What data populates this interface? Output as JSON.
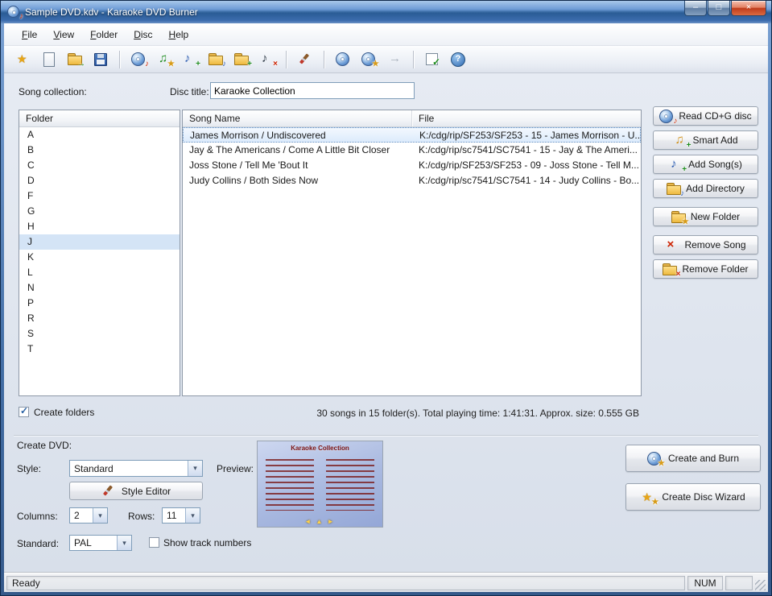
{
  "window": {
    "title": "Sample DVD.kdv - Karaoke DVD Burner"
  },
  "colors": {
    "titlebar_blue": "#2e62a8",
    "close_red": "#c73a1d",
    "selection_blue": "#d4e4f6",
    "folder_yellow": "#edb93f"
  },
  "menu": {
    "items": [
      "File",
      "View",
      "Folder",
      "Disc",
      "Help"
    ]
  },
  "toolbar": {
    "icons": [
      "new-project-wizard",
      "new-document",
      "open-file",
      "save",
      "read-cdg-disc",
      "smart-add",
      "add-songs",
      "add-directory",
      "new-folder",
      "remove-song",
      "style-editor",
      "create-and-burn",
      "create-disc-wizard",
      "forward-disabled",
      "check-disc",
      "help"
    ]
  },
  "collection": {
    "song_collection_label": "Song collection:",
    "disc_title_label": "Disc title:",
    "disc_title_value": "Karaoke Collection"
  },
  "folders": {
    "header": "Folder",
    "selected": "J",
    "items": [
      "A",
      "B",
      "C",
      "D",
      "F",
      "G",
      "H",
      "J",
      "K",
      "L",
      "N",
      "P",
      "R",
      "S",
      "T"
    ]
  },
  "songs": {
    "columns": {
      "name": "Song Name",
      "file": "File"
    },
    "selected_index": 0,
    "rows": [
      {
        "name": "James Morrison / Undiscovered",
        "file": "K:/cdg/rip/SF253/SF253 - 15 - James Morrison - U..."
      },
      {
        "name": "Jay & The Americans / Come A Little Bit Closer",
        "file": "K:/cdg/rip/sc7541/SC7541 - 15 - Jay & The Ameri..."
      },
      {
        "name": "Joss Stone / Tell Me 'Bout It",
        "file": "K:/cdg/rip/SF253/SF253 - 09 - Joss Stone - Tell M..."
      },
      {
        "name": "Judy Collins / Both Sides Now",
        "file": "K:/cdg/rip/sc7541/SC7541 - 14 - Judy Collins - Bo..."
      }
    ]
  },
  "side_buttons": {
    "read_cdg": "Read CD+G disc",
    "smart_add": "Smart Add",
    "add_songs": "Add Song(s)",
    "add_directory": "Add Directory",
    "new_folder": "New Folder",
    "remove_song": "Remove Song",
    "remove_folder": "Remove Folder"
  },
  "footer": {
    "create_folders_label": "Create folders",
    "create_folders_checked": true,
    "stats": "30 songs in 15 folder(s). Total playing time: 1:41:31. Approx. size: 0.555 GB"
  },
  "create_dvd": {
    "section_label": "Create DVD:",
    "style_label": "Style:",
    "style_value": "Standard",
    "style_editor_label": "Style Editor",
    "preview_label": "Preview:",
    "preview_title": "Karaoke Collection",
    "columns_label": "Columns:",
    "columns_value": "2",
    "rows_label": "Rows:",
    "rows_value": "11",
    "standard_label": "Standard:",
    "standard_value": "PAL",
    "show_track_numbers_label": "Show track numbers",
    "show_track_numbers_checked": false,
    "create_and_burn_label": "Create and Burn",
    "create_disc_wizard_label": "Create Disc Wizard"
  },
  "status_bar": {
    "ready": "Ready",
    "num": "NUM"
  },
  "glyphs": {
    "minimize": "–",
    "maximize": "□",
    "close": "×",
    "dropdown": "▾",
    "check": "✓",
    "plus": "+",
    "cross": "×",
    "note": "♪",
    "notes": "♫",
    "star": "★",
    "arrow": "→",
    "question": "?",
    "nav_arrows": "◄ ▲ ►"
  }
}
